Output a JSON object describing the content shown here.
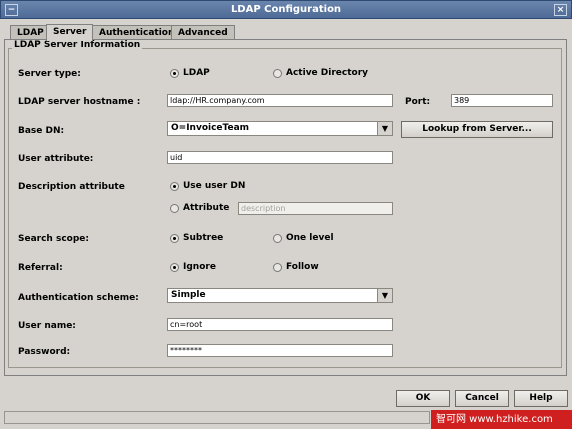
{
  "window": {
    "title": "LDAP Configuration",
    "minimize_glyph": "−",
    "close_glyph": "×"
  },
  "tabs": [
    {
      "label": "LDAP"
    },
    {
      "label": "Server",
      "active": true
    },
    {
      "label": "Authentication"
    },
    {
      "label": "Advanced"
    }
  ],
  "group": {
    "title": "LDAP Server Information"
  },
  "fields": {
    "server_type_label": "Server type:",
    "server_type_ldap": "LDAP",
    "server_type_ad": "Active Directory",
    "hostname_label": "LDAP server hostname :",
    "hostname_value": "ldap://HR.company.com",
    "port_label": "Port:",
    "port_value": "389",
    "base_dn_label": "Base DN:",
    "base_dn_value": "O=InvoiceTeam",
    "lookup_button": "Lookup from Server...",
    "user_attr_label": "User attribute:",
    "user_attr_value": "uid",
    "desc_attr_label": "Description attribute",
    "use_user_dn": "Use user DN",
    "attribute_label": "Attribute",
    "attribute_placeholder": "description",
    "search_scope_label": "Search scope:",
    "subtree": "Subtree",
    "one_level": "One level",
    "referral_label": "Referral:",
    "ignore": "Ignore",
    "follow": "Follow",
    "auth_scheme_label": "Authentication scheme:",
    "auth_scheme_value": "Simple",
    "user_name_label": "User name:",
    "user_name_value": "cn=root",
    "password_label": "Password:",
    "password_value": "********"
  },
  "footer": {
    "ok": "OK",
    "cancel": "Cancel",
    "help": "Help"
  },
  "overlay": {
    "watermark": "智可网 www.hzhike.com"
  }
}
